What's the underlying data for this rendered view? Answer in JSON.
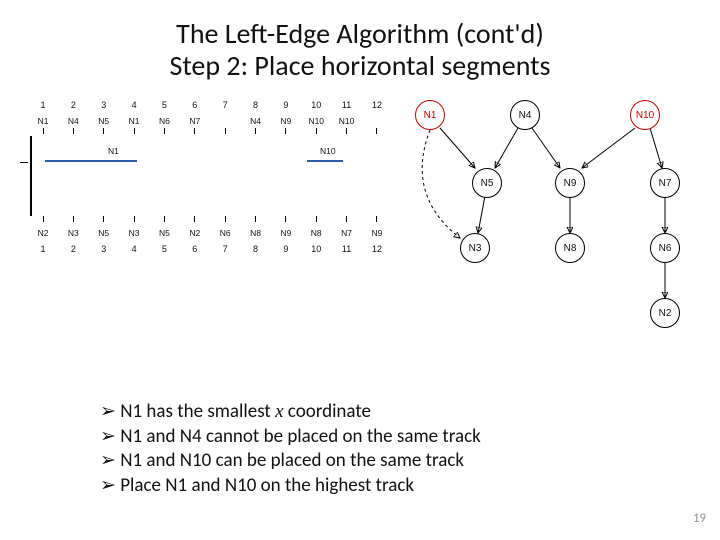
{
  "title_line1": "The Left-Edge Algorithm (cont'd)",
  "title_line2": "Step 2: Place horizontal segments",
  "top_numbers": [
    "1",
    "2",
    "3",
    "4",
    "5",
    "6",
    "7",
    "8",
    "9",
    "10",
    "11",
    "12"
  ],
  "top_labels": [
    "N1",
    "N4",
    "N5",
    "N1",
    "N6",
    "N7",
    "",
    "N4",
    "N9",
    "N10",
    "N10",
    ""
  ],
  "seg_n1_label": "N1",
  "seg_n10_label": "N10",
  "bot_labels": [
    "N2",
    "N3",
    "N5",
    "N3",
    "N5",
    "N2",
    "N6",
    "N8",
    "N9",
    "N8",
    "N7",
    "N9"
  ],
  "bot_numbers": [
    "1",
    "2",
    "3",
    "4",
    "5",
    "6",
    "7",
    "8",
    "9",
    "10",
    "11",
    "12"
  ],
  "nodes": {
    "n1": "N1",
    "n4": "N4",
    "n10": "N10",
    "n5": "N5",
    "n9": "N9",
    "n7": "N7",
    "n3": "N3",
    "n8": "N8",
    "n6": "N6",
    "n2": "N2"
  },
  "bullets": [
    {
      "pre": "N1 has the smallest ",
      "var": "x",
      "post": " coordinate"
    },
    {
      "pre": "N1 and N4 cannot be placed on the same track",
      "var": "",
      "post": ""
    },
    {
      "pre": "N1 and N10 can be placed on the same track",
      "var": "",
      "post": ""
    },
    {
      "pre": "Place N1 and N10 on the highest track",
      "var": "",
      "post": ""
    }
  ],
  "page_number": "19"
}
